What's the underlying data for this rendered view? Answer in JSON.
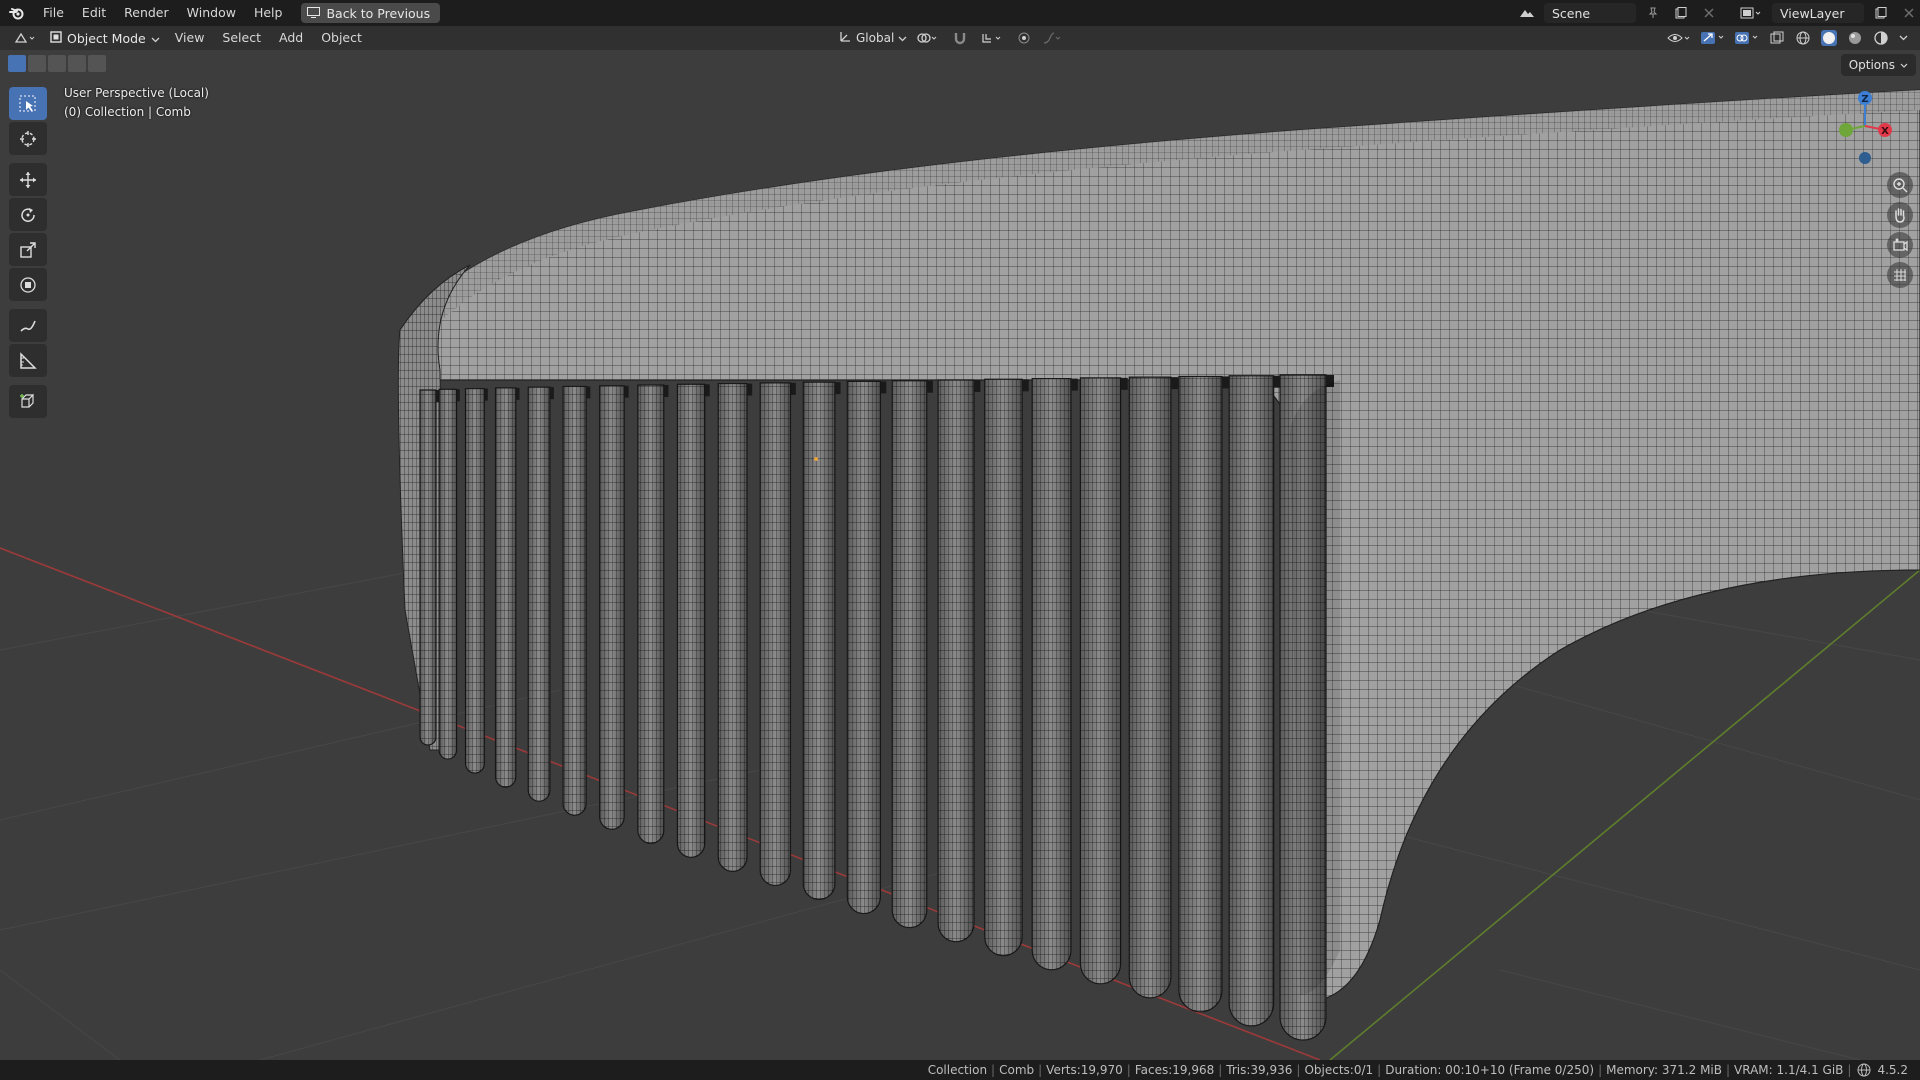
{
  "topbar": {
    "menus": [
      "File",
      "Edit",
      "Render",
      "Window",
      "Help"
    ],
    "back_button": "Back to Previous",
    "scene": "Scene",
    "view_layer": "ViewLayer"
  },
  "header": {
    "mode": "Object Mode",
    "menus": [
      "View",
      "Select",
      "Add",
      "Object"
    ],
    "transform_orientation": "Global"
  },
  "viewport": {
    "perspective_label": "User Perspective (Local)",
    "collection_label": "(0) Collection | Comb",
    "options_label": "Options"
  },
  "gizmo": {
    "z_label": "Z",
    "x_label": "X",
    "x_color": "#e0394a",
    "y_color": "#6ea63a",
    "z_color": "#3d7fd4"
  },
  "statusbar": {
    "collection": "Collection",
    "object": "Comb",
    "verts": "Verts:19,970",
    "faces": "Faces:19,968",
    "tris": "Tris:39,936",
    "objects": "Objects:0/1",
    "duration": "Duration: 00:10+10 (Frame 0/250)",
    "memory": "Memory: 371.2 MiB",
    "vram": "VRAM: 1.1/4.1 GiB",
    "version": "4.5.2"
  },
  "colors": {
    "accent": "#4772b3",
    "x_axis_line": "#9c3a3a",
    "y_axis_line": "#5e7e2c",
    "mesh_fill": "#9a9a9a",
    "wire": "#1a1a1a"
  }
}
